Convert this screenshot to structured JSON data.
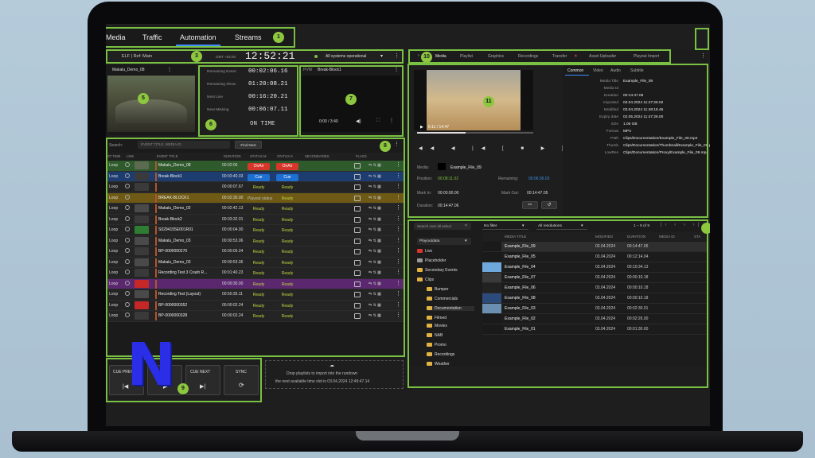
{
  "nav": {
    "tabs": [
      "Media",
      "Traffic",
      "Automation",
      "Streams"
    ],
    "active": "Automation"
  },
  "channel": {
    "name": "ELF | Ref: Main",
    "tz": "GMT +02:00",
    "clock": "12:52:21",
    "status": "All systems operational"
  },
  "right_tabs": [
    "Media",
    "Playlist",
    "Graphics",
    "Recordings",
    "Transfer",
    "Asset Uploader",
    "Playout Import"
  ],
  "live": {
    "title": "Makalu_Demo_08"
  },
  "timers": [
    {
      "label": "Remaining Event",
      "value": "00:02:06.16"
    },
    {
      "label": "Remaining Show",
      "value": "01:20:08.21"
    },
    {
      "label": "Next Live",
      "value": "00:16:20.21"
    },
    {
      "label": "Next Missing",
      "value": "00:06:07.11"
    }
  ],
  "timers_state": "ON TIME",
  "pvw": {
    "label": "PVW",
    "title": "Break-Block1",
    "time": "0:00 / 3:40"
  },
  "rundown": {
    "search_label": "Search:",
    "search_placeholder": "EVENT TITLE, MEDIA ID",
    "find_next": "Find Next",
    "headers": [
      "ST TIME",
      "LINK",
      "EVENT TITLE",
      "DURATION",
      "STATUS M",
      "STATUS S",
      "SECONDARIES",
      "FLAGS"
    ],
    "rows": [
      {
        "mode": "Loop",
        "title": "Makalu_Demo_08",
        "dur": "00:02:06",
        "s1": "OnAir",
        "s2": "OnAir"
      },
      {
        "mode": "Loop",
        "title": "Break-Block1",
        "dur": "00:03:40.03",
        "s1": "Cue",
        "s2": "Cue"
      },
      {
        "mode": "Loop",
        "title": "",
        "dur": "00:00:07.67",
        "s1": "Ready",
        "s2": "Ready"
      },
      {
        "mode": "Loop",
        "title": "BREAK-BLOCK1",
        "dur": "00:02:30.00",
        "s1": "Playout status",
        "s2": "Ready"
      },
      {
        "mode": "Loop",
        "title": "Makalu_Demo_02",
        "dur": "00:02:42.13",
        "s1": "Ready",
        "s2": "Ready"
      },
      {
        "mode": "Loop",
        "title": "Break-Block2",
        "dur": "00:03:32.01",
        "s1": "Ready",
        "s2": "Ready"
      },
      {
        "mode": "Loop",
        "title": "S0294155E001R01",
        "dur": "00:00:04.00",
        "s1": "Ready",
        "s2": "Ready"
      },
      {
        "mode": "Loop",
        "title": "Makalu_Demo_03",
        "dur": "00:00:53.06",
        "s1": "Ready",
        "s2": "Ready"
      },
      {
        "mode": "Loop",
        "title": "BP-0000000270",
        "dur": "00:00:05.24",
        "s1": "Ready",
        "s2": "Ready"
      },
      {
        "mode": "Loop",
        "title": "Makalu_Demo_03",
        "dur": "00:00:53.06",
        "s1": "Ready",
        "s2": "Ready"
      },
      {
        "mode": "Loop",
        "title": "Recording Test 3 Crash R...",
        "dur": "00:01:40.23",
        "s1": "Ready",
        "s2": "Ready"
      },
      {
        "mode": "Loop",
        "title": "",
        "dur": "00:00:30.00",
        "s1": "Ready",
        "s2": "Ready"
      },
      {
        "mode": "Loop",
        "title": "Recording Test (Layout)",
        "dur": "00:50:35.11",
        "s1": "Ready",
        "s2": "Ready"
      },
      {
        "mode": "Loop",
        "title": "BP-0000000352",
        "dur": "00:00:02.24",
        "s1": "Ready",
        "s2": "Ready"
      },
      {
        "mode": "Loop",
        "title": "BP-0000000328",
        "dur": "00:00:02.24",
        "s1": "Ready",
        "s2": "Ready"
      }
    ]
  },
  "controls": {
    "cue_prev": "CUE PREV",
    "play": "PLAY",
    "cue_next": "CUE NEXT",
    "sync": "SYNC"
  },
  "drop": {
    "line1": "Drop playlists to import into the rundown",
    "line2": "the next available time slot is 03.04.2024 12:49:47.14"
  },
  "player": {
    "time": "6:11 / 14:47",
    "media": "Example_File_09",
    "position": "00:08:11.02",
    "remaining": "00:06:36.03",
    "mark_in": "00:00:00.00",
    "mark_out": "00:14:47.05",
    "duration": "00:14:47.06",
    "labels": {
      "media": "Media:",
      "position": "Position:",
      "remaining": "Remaining:",
      "mark_in": "Mark In:",
      "mark_out": "Mark Out:",
      "duration": "Duration:"
    }
  },
  "meta": {
    "tabs": [
      "Common",
      "Video",
      "Audio",
      "Subtitle"
    ],
    "fields": [
      {
        "k": "Media Title",
        "v": "Example_File_09"
      },
      {
        "k": "Media Id",
        "v": ""
      },
      {
        "k": "Duration",
        "v": "00:14:47.06"
      },
      {
        "k": "Imported",
        "v": "03.04.2024 11:47:26.02"
      },
      {
        "k": "Modified",
        "v": "03.04.2024 11:48:18.46"
      },
      {
        "k": "Expiry date",
        "v": "02.05.2024 11:47:26.00"
      },
      {
        "k": "Size",
        "v": "1.06 GB"
      },
      {
        "k": "Format",
        "v": "MP4"
      },
      {
        "k": "Path",
        "v": "Clips/Documentation/Example_File_09.mp4"
      },
      {
        "k": "Thumb",
        "v": "Clips/Documentation/Thumbnail/Example_File_09.png"
      },
      {
        "k": "LowRes",
        "v": "Clips/Documentation/Proxy/Example_File_09.mp4"
      }
    ]
  },
  "browser": {
    "search_placeholder": "Search over all select",
    "filter": "No filter",
    "resolution": "All resolutions",
    "pager": "1 – 9 of 9",
    "root": "Playoutdata",
    "tree": [
      {
        "name": "Live",
        "icon": "red",
        "indent": 0
      },
      {
        "name": "Placeholder",
        "icon": "plain",
        "indent": 0
      },
      {
        "name": "Secondary Events",
        "icon": "folder",
        "indent": 0
      },
      {
        "name": "Clips",
        "icon": "folder",
        "indent": 0
      },
      {
        "name": "Bumper",
        "icon": "folder",
        "indent": 1
      },
      {
        "name": "Commercials",
        "icon": "folder",
        "indent": 1
      },
      {
        "name": "Documentation",
        "icon": "folder",
        "indent": 1
      },
      {
        "name": "Filmed",
        "icon": "folder",
        "indent": 1
      },
      {
        "name": "Movies",
        "icon": "folder",
        "indent": 1
      },
      {
        "name": "NAB",
        "icon": "folder",
        "indent": 1
      },
      {
        "name": "Promo",
        "icon": "folder",
        "indent": 1
      },
      {
        "name": "Recordings",
        "icon": "folder",
        "indent": 1
      },
      {
        "name": "Weather",
        "icon": "folder",
        "indent": 1
      }
    ],
    "headers": [
      "MEDIA TITLE",
      "MODIFIED",
      "DURATION",
      "MEDIA ID",
      "STA"
    ],
    "files": [
      {
        "title": "Example_File_09",
        "mod": "03.04.2024",
        "dur": "00:14:47.06"
      },
      {
        "title": "Example_File_05",
        "mod": "03.04.2024",
        "dur": "00:12:14.04"
      },
      {
        "title": "Example_File_04",
        "mod": "03.04.2024",
        "dur": "00:10:34.13"
      },
      {
        "title": "Example_File_07",
        "mod": "03.04.2024",
        "dur": "00:00:10.18"
      },
      {
        "title": "Example_File_06",
        "mod": "03.04.2024",
        "dur": "00:00:10.18"
      },
      {
        "title": "Example_File_08",
        "mod": "03.04.2024",
        "dur": "00:00:10.18"
      },
      {
        "title": "Example_File_03",
        "mod": "03.04.2024",
        "dur": "00:02:30.01"
      },
      {
        "title": "Example_File_02",
        "mod": "03.04.2024",
        "dur": "00:02:26.00"
      },
      {
        "title": "Example_File_01",
        "mod": "03.04.2024",
        "dur": "00:01:30.00"
      }
    ]
  },
  "callouts": [
    "1",
    "3",
    "5",
    "6",
    "7",
    "8",
    "9",
    "10",
    "11"
  ],
  "logo_letter": "N",
  "colors": {
    "accent": "#7ac143",
    "onair": "#d9362b",
    "cue": "#1f6fd1",
    "ready": "#c6d441",
    "logo": "#2a2ee6"
  }
}
